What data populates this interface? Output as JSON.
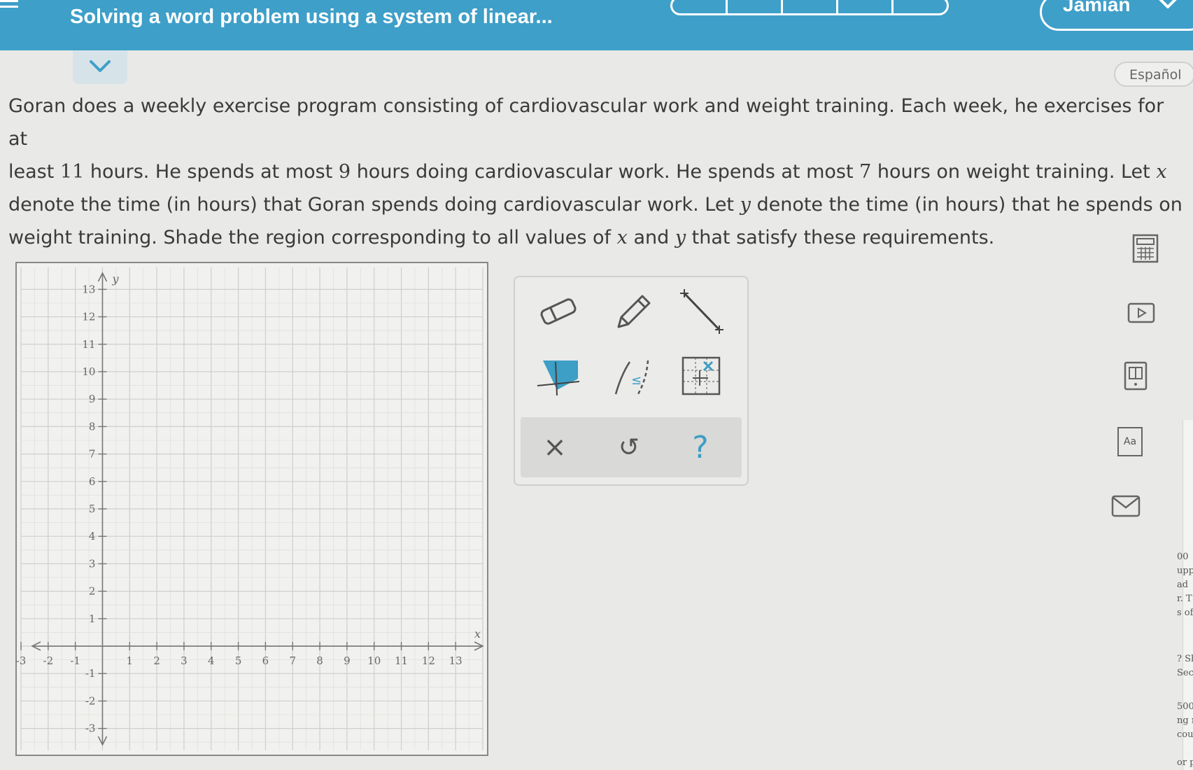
{
  "header": {
    "title": "Solving a word problem using a system of linear...",
    "user_name": "Jamian",
    "progress_segments": 5
  },
  "language_button": "Español",
  "problem": {
    "s1": "Goran does a weekly exercise program consisting of cardiovascular work and weight training. Each week, he exercises for at",
    "s2a": "least ",
    "n11": "11",
    "s2b": " hours. He spends at most ",
    "n9": "9",
    "s2c": " hours doing cardiovascular work. He spends at most ",
    "n7": "7",
    "s2d": " hours on weight training. Let ",
    "var_x": "x",
    "s3a": "denote the time (in hours) that Goran spends doing cardiovascular work. Let ",
    "var_y": "y",
    "s3b": " denote the time (in hours) that he spends on",
    "s4a": "weight training. Shade the region corresponding to all values of ",
    "s4b": " and ",
    "s4c": " that satisfy these requirements."
  },
  "graph": {
    "x_label": "x",
    "y_label": "y",
    "x_ticks": [
      "-3",
      "-2",
      "-1",
      "1",
      "2",
      "3",
      "4",
      "5",
      "6",
      "7",
      "8",
      "9",
      "10",
      "11",
      "12",
      "13"
    ],
    "y_ticks": [
      "13",
      "12",
      "11",
      "10",
      "9",
      "8",
      "7",
      "6",
      "5",
      "4",
      "3",
      "2",
      "1",
      "-1",
      "-2",
      "-3"
    ],
    "x_range": [
      -3,
      14
    ],
    "y_range": [
      -3.8,
      13.8
    ]
  },
  "tools": {
    "eraser": "eraser-icon",
    "pencil": "pencil-icon",
    "line": "line-tool-icon",
    "shade": "shade-region-icon",
    "inequality": "inequality-tool-icon",
    "grid_point": "grid-point-icon",
    "clear": "×",
    "undo": "↺",
    "help": "?"
  },
  "side_icons": [
    "calculator-icon",
    "video-icon",
    "book-icon",
    "glossary-icon",
    "mail-icon"
  ],
  "glossary_label": "Aa",
  "edge_fragments": [
    "00",
    "upp",
    "ad",
    "r. T",
    "s of",
    "? Sh",
    "Secu",
    "500",
    "ng ma",
    "could",
    "or pro"
  ]
}
